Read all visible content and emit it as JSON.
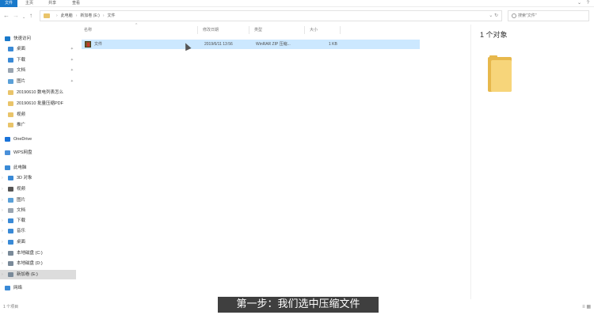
{
  "ribbon": {
    "tabs": [
      "文件",
      "主页",
      "共享",
      "查看"
    ],
    "controls": [
      "⌄",
      "?"
    ]
  },
  "address": {
    "breadcrumbs": [
      "此电脑",
      "新加卷 (E:)",
      "文件"
    ],
    "search_placeholder": "搜索\"文件\""
  },
  "sidebar": {
    "items": [
      {
        "label": "快速访问",
        "icon": "star-icon",
        "color": "#1979ca"
      },
      {
        "label": "桌面",
        "icon": "desktop-icon",
        "color": "#3a8ad6",
        "pinned": true
      },
      {
        "label": "下载",
        "icon": "download-icon",
        "color": "#3a8ad6",
        "pinned": true
      },
      {
        "label": "文档",
        "icon": "document-icon",
        "color": "#9aa5b1",
        "pinned": true
      },
      {
        "label": "图片",
        "icon": "pictures-icon",
        "color": "#5aa0d8",
        "pinned": true
      },
      {
        "label": "20190610 数电列表怎么",
        "icon": "folder-icon",
        "color": "#e9c46a"
      },
      {
        "label": "20190610 批量压缩PDF",
        "icon": "folder-icon",
        "color": "#e9c46a"
      },
      {
        "label": "视频",
        "icon": "folder-icon",
        "color": "#e9c46a"
      },
      {
        "label": "推广",
        "icon": "folder-icon",
        "color": "#e9c46a"
      },
      {
        "label": "OneDrive",
        "icon": "cloud-icon",
        "color": "#1a73d9"
      },
      {
        "label": "WPS网盘",
        "icon": "cloud-outline-icon",
        "color": "#4a90d9"
      },
      {
        "label": "此电脑",
        "icon": "computer-icon",
        "color": "#3a8ad6"
      },
      {
        "label": "3D 对象",
        "icon": "cube-icon",
        "color": "#3a8ad6"
      },
      {
        "label": "视频",
        "icon": "video-icon",
        "color": "#555555"
      },
      {
        "label": "图片",
        "icon": "pictures-icon",
        "color": "#5aa0d8"
      },
      {
        "label": "文档",
        "icon": "document-icon",
        "color": "#9aa5b1"
      },
      {
        "label": "下载",
        "icon": "download-icon",
        "color": "#3a8ad6"
      },
      {
        "label": "音乐",
        "icon": "music-icon",
        "color": "#3a8ad6"
      },
      {
        "label": "桌面",
        "icon": "desktop-icon",
        "color": "#3a8ad6"
      },
      {
        "label": "本地磁盘 (C:)",
        "icon": "drive-icon",
        "color": "#7a8a99"
      },
      {
        "label": "本地磁盘 (D:)",
        "icon": "drive-icon",
        "color": "#7a8a99"
      },
      {
        "label": "新加卷 (E:)",
        "icon": "drive-icon",
        "color": "#7a8a99",
        "selected": true
      },
      {
        "label": "网络",
        "icon": "network-icon",
        "color": "#3a8ad6"
      }
    ]
  },
  "list": {
    "columns": [
      "名称",
      "修改日期",
      "类型",
      "大小"
    ],
    "files": [
      {
        "name": "文件",
        "modified": "2019/6/11 13:56",
        "type": "WinRAR ZIP 压缩...",
        "size": "1 KB"
      }
    ]
  },
  "preview": {
    "count_text": "1 个对象"
  },
  "statusbar": {
    "text": "1 个项目"
  },
  "caption": "第一步：我们选中压缩文件",
  "colors": {
    "accent": "#1979ca",
    "selection": "#cce8ff",
    "folder": "#e9c46a"
  }
}
